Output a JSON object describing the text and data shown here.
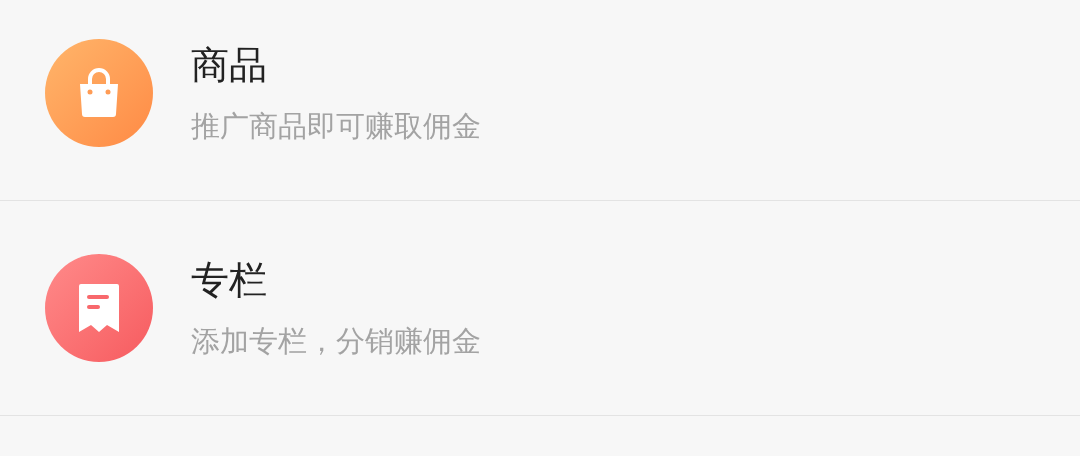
{
  "items": [
    {
      "kind": "bag",
      "title": "商品",
      "subtitle": "推广商品即可赚取佣金"
    },
    {
      "kind": "column",
      "title": "专栏",
      "subtitle": "添加专栏，分销赚佣金"
    }
  ]
}
